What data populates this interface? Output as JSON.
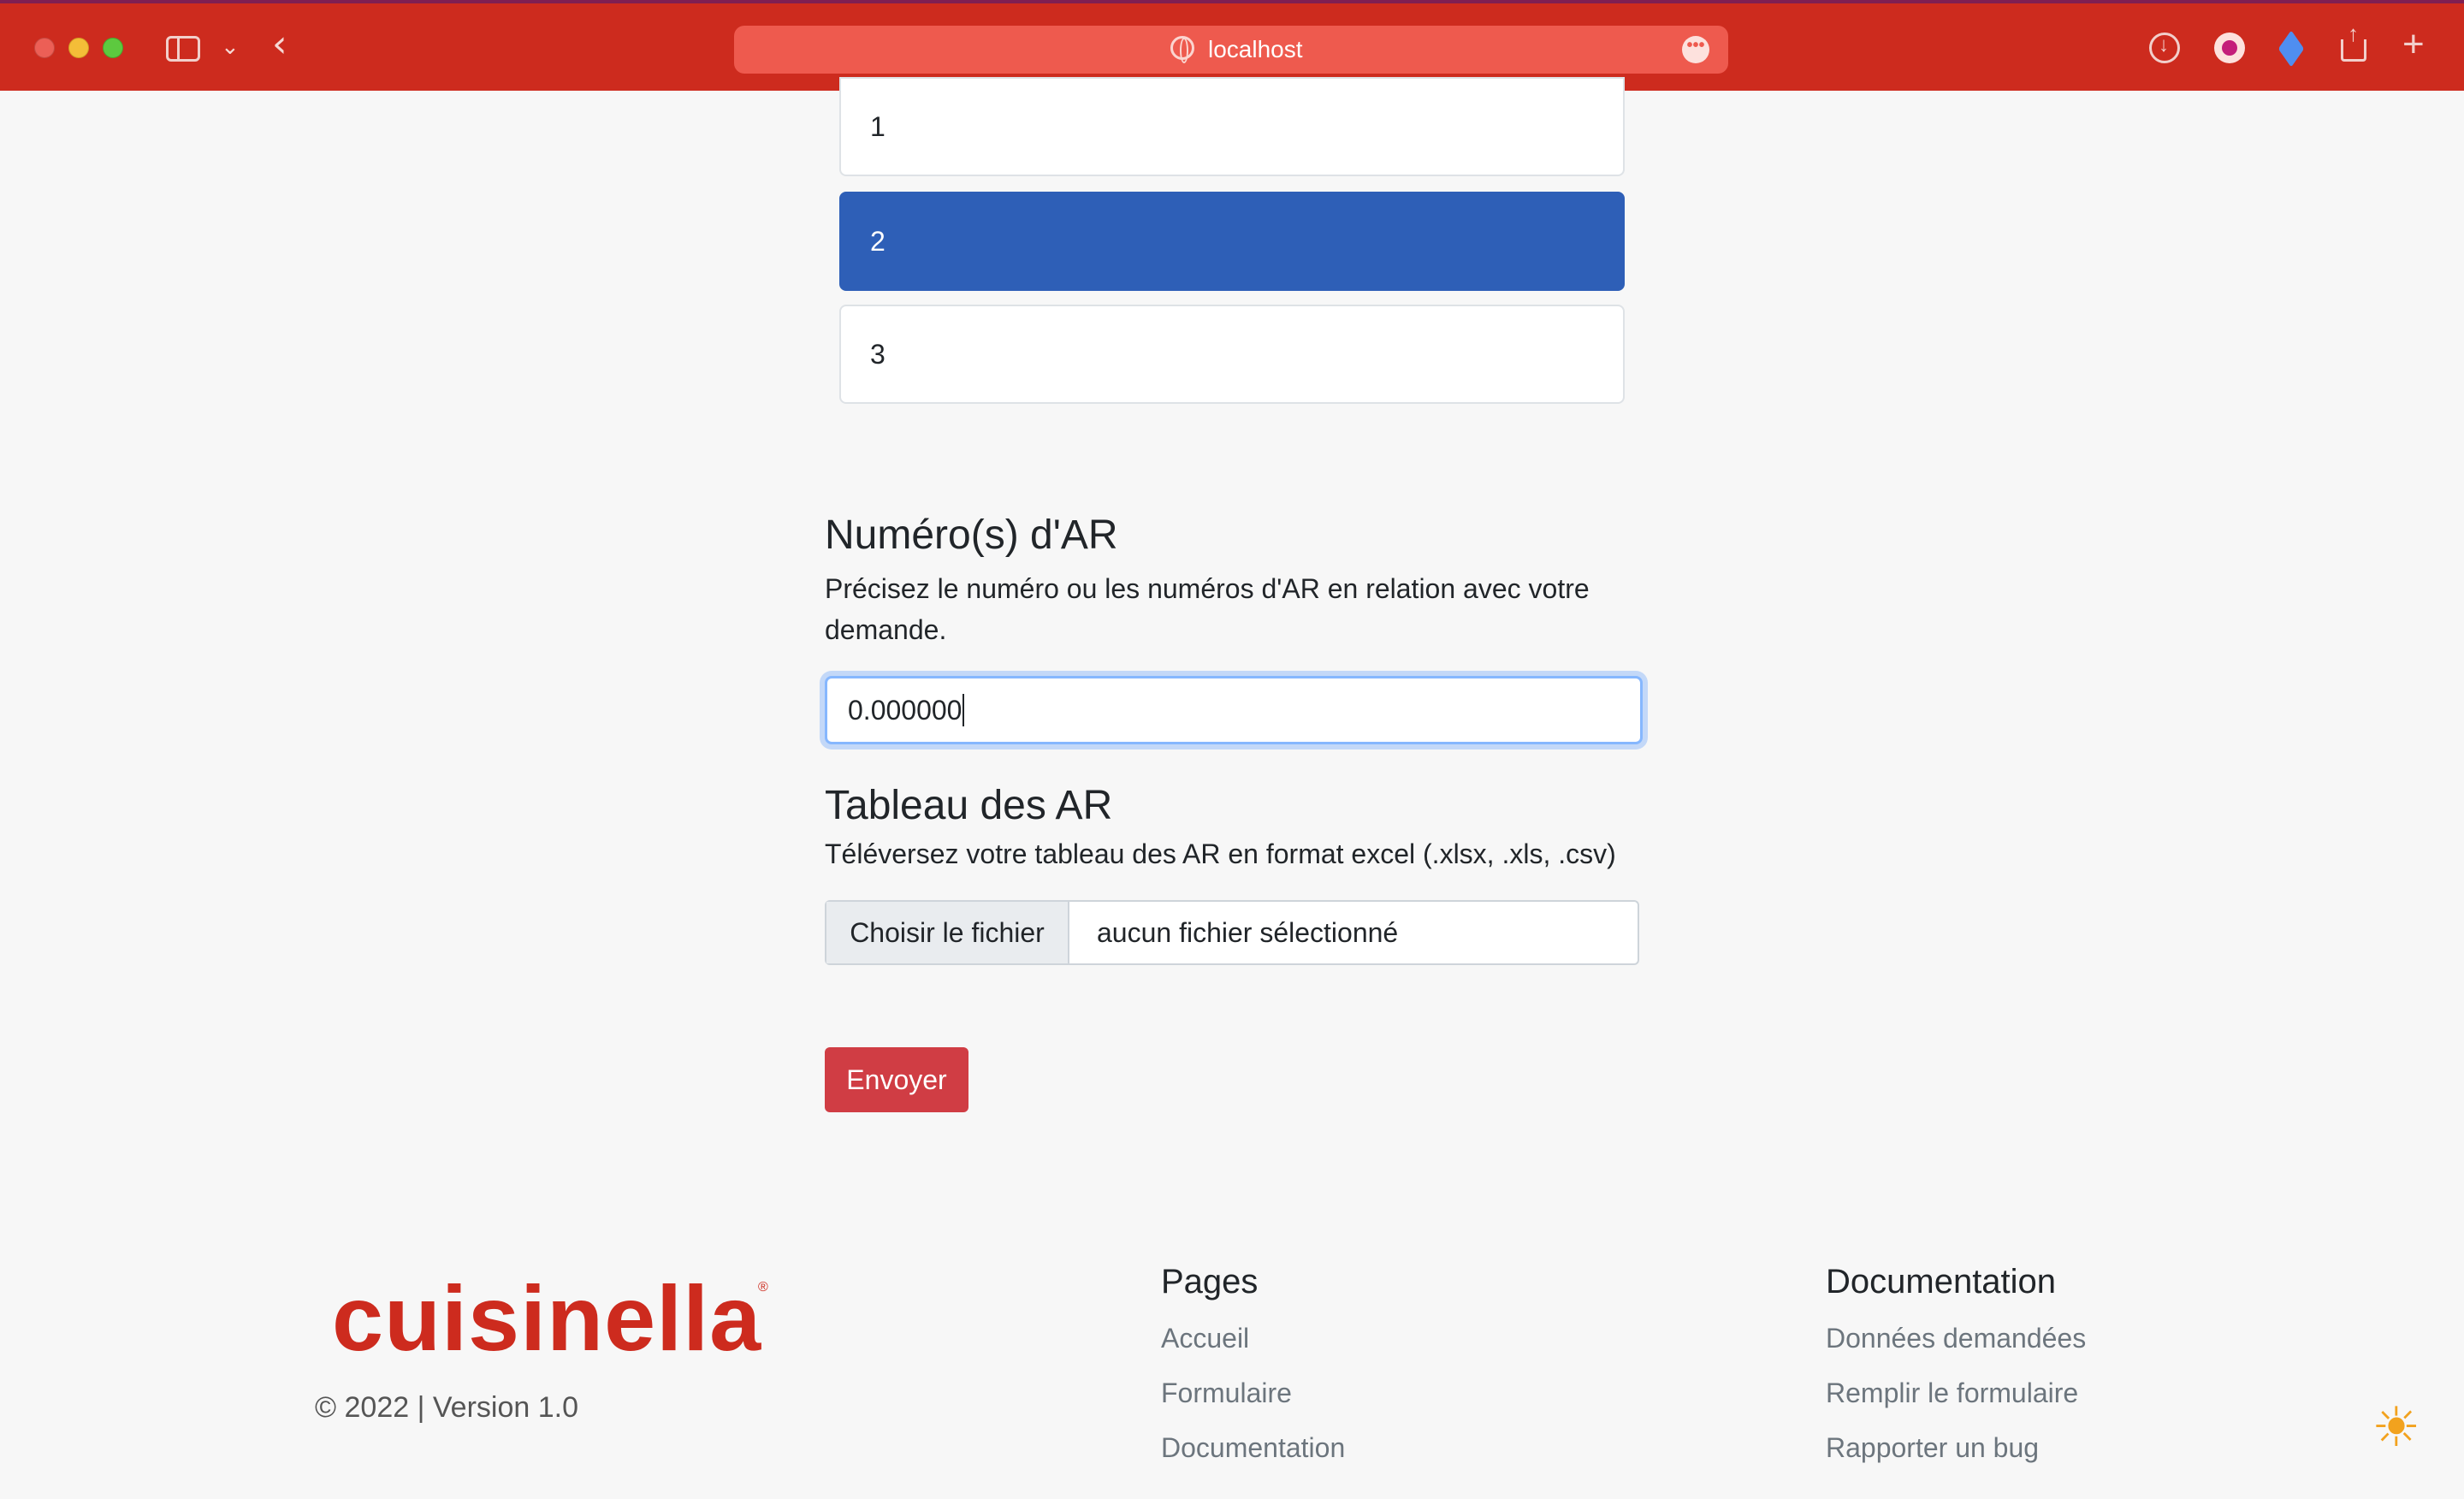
{
  "browser": {
    "url": "localhost",
    "more_glyph": "•••"
  },
  "list": {
    "items": [
      "1",
      "2",
      "3"
    ],
    "selected": "2"
  },
  "ar_section": {
    "title": "Numéro(s) d'AR",
    "help": "Précisez le numéro ou les numéros d'AR en relation avec votre demande.",
    "input_value": "0.000000"
  },
  "table_section": {
    "title": "Tableau des AR",
    "help": "Téléversez votre tableau des AR en format excel (.xlsx, .xls, .csv)",
    "file_button": "Choisir le fichier",
    "file_status": "aucun fichier sélectionné"
  },
  "submit_label": "Envoyer",
  "footer": {
    "brand": "cuisinella",
    "brand_mark": "®",
    "copyright": "© 2022 | Version 1.0",
    "pages": {
      "title": "Pages",
      "links": [
        "Accueil",
        "Formulaire",
        "Documentation"
      ]
    },
    "documentation": {
      "title": "Documentation",
      "links": [
        "Données demandées",
        "Remplir le formulaire",
        "Rapporter un bug"
      ]
    }
  },
  "colors": {
    "chrome": "#cd2b1e",
    "selected_item": "#2e5fb7",
    "submit": "#d03d44",
    "brand": "#cd2b1e"
  }
}
